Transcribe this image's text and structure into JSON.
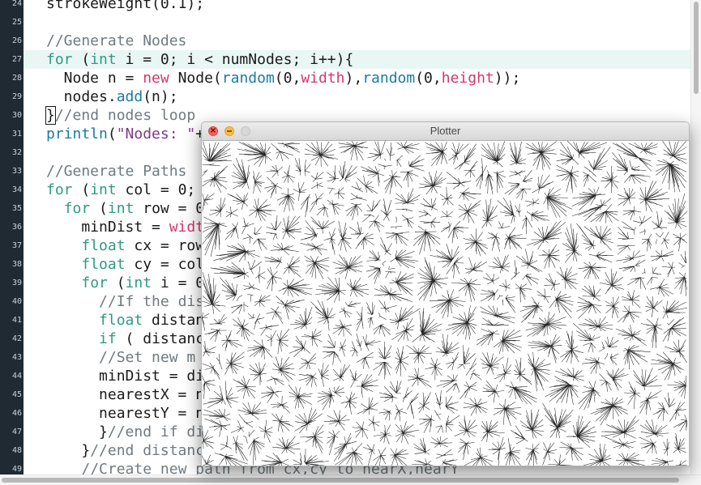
{
  "editor": {
    "lines": [
      {
        "n": "24",
        "html": "strokeWeight(0.1);"
      },
      {
        "n": "25",
        "html": ""
      },
      {
        "n": "26",
        "html": "<span class='cm'>//Generate Nodes</span>"
      },
      {
        "n": "27",
        "html": "<span class='kw'>for</span> (<span class='kw'>int</span> i = 0; i &lt; numNodes; i++){",
        "hl": true
      },
      {
        "n": "28",
        "html": "  Node n = <span class='nw'>new</span> Node(<span class='fn'>random</span>(0,<span class='nw'>width</span>),<span class='fn'>random</span>(0,<span class='nw'>height</span>));"
      },
      {
        "n": "29",
        "html": "  nodes.<span class='fn'>add</span>(n);"
      },
      {
        "n": "30",
        "html": "<span class='cursor-br'>}</span><span class='cm'>//end nodes loop</span>"
      },
      {
        "n": "31",
        "html": "<span class='fn'>println</span>(<span class='st'>\"Nodes: \"</span>+"
      },
      {
        "n": "32",
        "html": ""
      },
      {
        "n": "33",
        "html": "<span class='cm'>//Generate Paths</span>"
      },
      {
        "n": "34",
        "html": "<span class='kw'>for</span> (<span class='kw'>int</span> col = 0;"
      },
      {
        "n": "35",
        "html": "  <span class='kw'>for</span> (<span class='kw'>int</span> row = 0"
      },
      {
        "n": "36",
        "html": "    minDist = <span class='nw'>width</span>"
      },
      {
        "n": "37",
        "html": "    <span class='kw'>float</span> cx = row"
      },
      {
        "n": "38",
        "html": "    <span class='kw'>float</span> cy = col"
      },
      {
        "n": "39",
        "html": "    <span class='kw'>for</span> (<span class='kw'>int</span> i = 0"
      },
      {
        "n": "40",
        "html": "      <span class='cm'>//If the dis</span>"
      },
      {
        "n": "41",
        "html": "      <span class='kw'>float</span> distan"
      },
      {
        "n": "42",
        "html": "      <span class='kw'>if</span> ( distanc"
      },
      {
        "n": "43",
        "html": "      <span class='cm'>//Set new m</span>"
      },
      {
        "n": "44",
        "html": "      minDist = di"
      },
      {
        "n": "45",
        "html": "      nearestX = n"
      },
      {
        "n": "46",
        "html": "      nearestY = n"
      },
      {
        "n": "47",
        "html": "      }<span class='cm'>//end if di</span>"
      },
      {
        "n": "48",
        "html": "    }<span class='cm'>//end distanc</span>"
      },
      {
        "n": "49",
        "html": "    <span class='cm'>//Create new path from cx,cy to nearX,nearY</span>"
      }
    ]
  },
  "plotter": {
    "title": "Plotter",
    "close_glyph": "×"
  },
  "colors": {
    "gutter_bg": "#1f2a33",
    "keyword": "#2f9a82",
    "function": "#1b7aa4",
    "comment": "#707a80",
    "string": "#7c3a8a",
    "builtin": "#d1396b",
    "highlight_line": "#e9f7f4"
  }
}
